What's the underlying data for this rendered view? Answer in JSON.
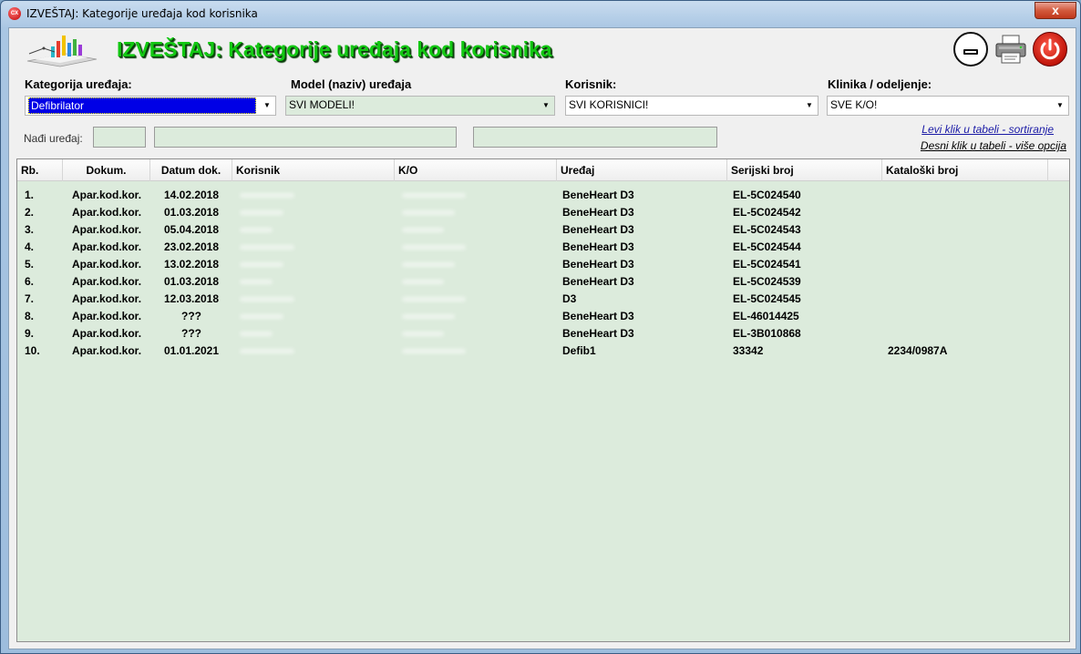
{
  "window": {
    "title": "IZVEŠTAJ: Kategorije uređaja kod korisnika",
    "close_label": "x"
  },
  "header": {
    "title": "IZVEŠTAJ: Kategorije uređaja kod korisnika"
  },
  "filters": {
    "category": {
      "label": "Kategorija uređaja:",
      "value": "Defibrilator"
    },
    "model": {
      "label": "Model (naziv) uređaja",
      "value": "SVI MODELI!"
    },
    "user": {
      "label": "Korisnik:",
      "value": "SVI KORISNICI!"
    },
    "clinic": {
      "label": "Klinika / odeljenje:",
      "value": "SVE K/O!"
    }
  },
  "find": {
    "label": "Nađi uređaj:"
  },
  "hints": {
    "sort": "Levi klik u tabeli - sortiranje",
    "options": "Desni klik u tabeli - više opcija"
  },
  "table": {
    "headers": [
      "Rb.",
      "Dokum.",
      "Datum dok.",
      "Korisnik",
      "K/O",
      "Uređaj",
      "Serijski broj",
      "Kataloški broj"
    ],
    "rows": [
      {
        "rb": "1.",
        "dok": "Apar.kod.kor.",
        "datum": "14.02.2018",
        "uredjaj": "BeneHeart D3",
        "serijski": "EL-5C024540",
        "katalog": ""
      },
      {
        "rb": "2.",
        "dok": "Apar.kod.kor.",
        "datum": "01.03.2018",
        "uredjaj": "BeneHeart D3",
        "serijski": "EL-5C024542",
        "katalog": ""
      },
      {
        "rb": "3.",
        "dok": "Apar.kod.kor.",
        "datum": "05.04.2018",
        "uredjaj": "BeneHeart D3",
        "serijski": "EL-5C024543",
        "katalog": ""
      },
      {
        "rb": "4.",
        "dok": "Apar.kod.kor.",
        "datum": "23.02.2018",
        "uredjaj": "BeneHeart D3",
        "serijski": "EL-5C024544",
        "katalog": ""
      },
      {
        "rb": "5.",
        "dok": "Apar.kod.kor.",
        "datum": "13.02.2018",
        "uredjaj": "BeneHeart D3",
        "serijski": "EL-5C024541",
        "katalog": ""
      },
      {
        "rb": "6.",
        "dok": "Apar.kod.kor.",
        "datum": "01.03.2018",
        "uredjaj": "BeneHeart D3",
        "serijski": "EL-5C024539",
        "katalog": ""
      },
      {
        "rb": "7.",
        "dok": "Apar.kod.kor.",
        "datum": "12.03.2018",
        "uredjaj": "D3",
        "serijski": "EL-5C024545",
        "katalog": ""
      },
      {
        "rb": "8.",
        "dok": "Apar.kod.kor.",
        "datum": "???",
        "uredjaj": "BeneHeart D3",
        "serijski": "EL-46014425",
        "katalog": ""
      },
      {
        "rb": "9.",
        "dok": "Apar.kod.kor.",
        "datum": "???",
        "uredjaj": "BeneHeart D3",
        "serijski": "EL-3B010868",
        "katalog": ""
      },
      {
        "rb": "10.",
        "dok": "Apar.kod.kor.",
        "datum": "01.01.2021",
        "uredjaj": "Defib1",
        "serijski": "33342",
        "katalog": "2234/0987A"
      }
    ]
  },
  "icons": {
    "app": "app-icon",
    "minimize": "minimize-icon",
    "print": "printer-icon",
    "exit": "power-icon",
    "logo": "report-chart-logo"
  },
  "colors": {
    "title_green": "#13c813",
    "table_bg": "#dcebdc",
    "selection": "#0000e6"
  }
}
